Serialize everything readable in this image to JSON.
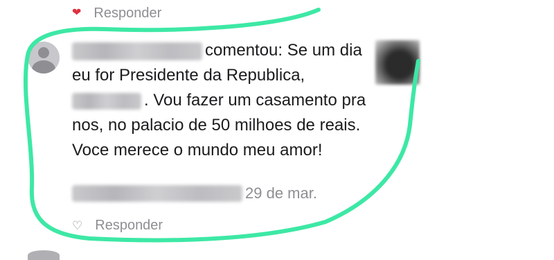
{
  "top_item": {
    "reply_label": "Responder",
    "like_icon": "heart-filled-icon",
    "like_color": "#e0303e"
  },
  "comment": {
    "action_text": "comentou: Se um dia eu for Presidente da Republica,",
    "body_text": ". Vou fazer um casamento pra nos, no palacio de 50 milhoes de reais. Voce merece o mundo meu amor!",
    "date": "29 de mar.",
    "reply_label": "Responder",
    "like_icon": "heart-outline-icon"
  },
  "annotation": {
    "color": "#3de8a5"
  }
}
